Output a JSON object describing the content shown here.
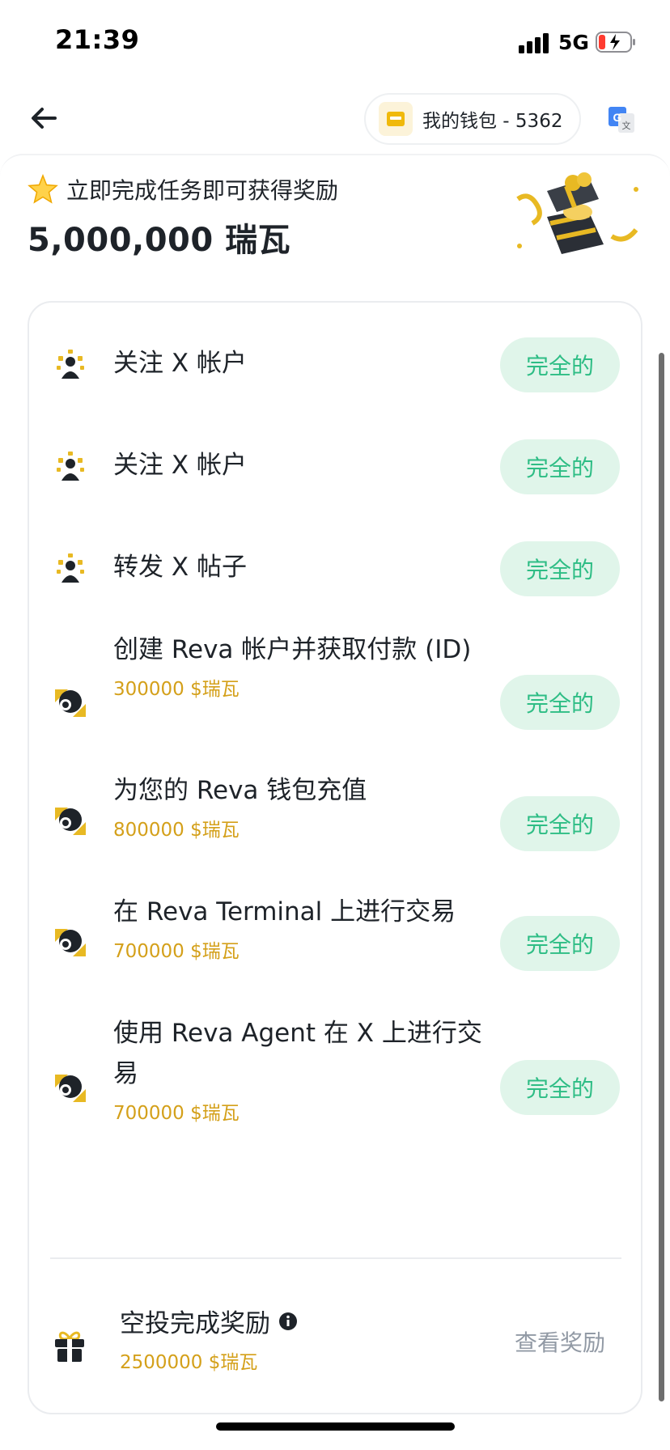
{
  "status_bar": {
    "time": "21:39",
    "network": "5G"
  },
  "header": {
    "wallet_label": "我的钱包 - 5362"
  },
  "hero": {
    "subtitle": "立即完成任务即可获得奖励",
    "amount": "5,000,000 瑞瓦"
  },
  "tasks": [
    {
      "icon": "people-icon",
      "title": "关注 X 帐户",
      "reward": "",
      "button": "完全的"
    },
    {
      "icon": "people-icon",
      "title": "关注 X 帐户",
      "reward": "",
      "button": "完全的"
    },
    {
      "icon": "people-icon",
      "title": "转发 X 帖子",
      "reward": "",
      "button": "完全的"
    },
    {
      "icon": "coins-icon",
      "title": "创建 Reva 帐户并获取付款 (ID)",
      "reward": "300000 $瑞瓦",
      "button": "完全的"
    },
    {
      "icon": "coins-icon",
      "title": "为您的 Reva 钱包充值",
      "reward": "800000 $瑞瓦",
      "button": "完全的"
    },
    {
      "icon": "coins-icon",
      "title": "在 Reva Terminal 上进行交易",
      "reward": "700000 $瑞瓦",
      "button": "完全的"
    },
    {
      "icon": "coins-icon",
      "title": "使用 Reva Agent 在 X 上进行交易",
      "reward": "700000 $瑞瓦",
      "button": "完全的"
    }
  ],
  "airdrop": {
    "title": "空投完成奖励",
    "reward": "2500000 $瑞瓦",
    "action": "查看奖励"
  },
  "colors": {
    "accent_gold": "#d4a01a",
    "done_bg": "#e0f5ea",
    "done_text": "#2ebd85",
    "text": "#1e2329",
    "muted": "#929aa5"
  }
}
